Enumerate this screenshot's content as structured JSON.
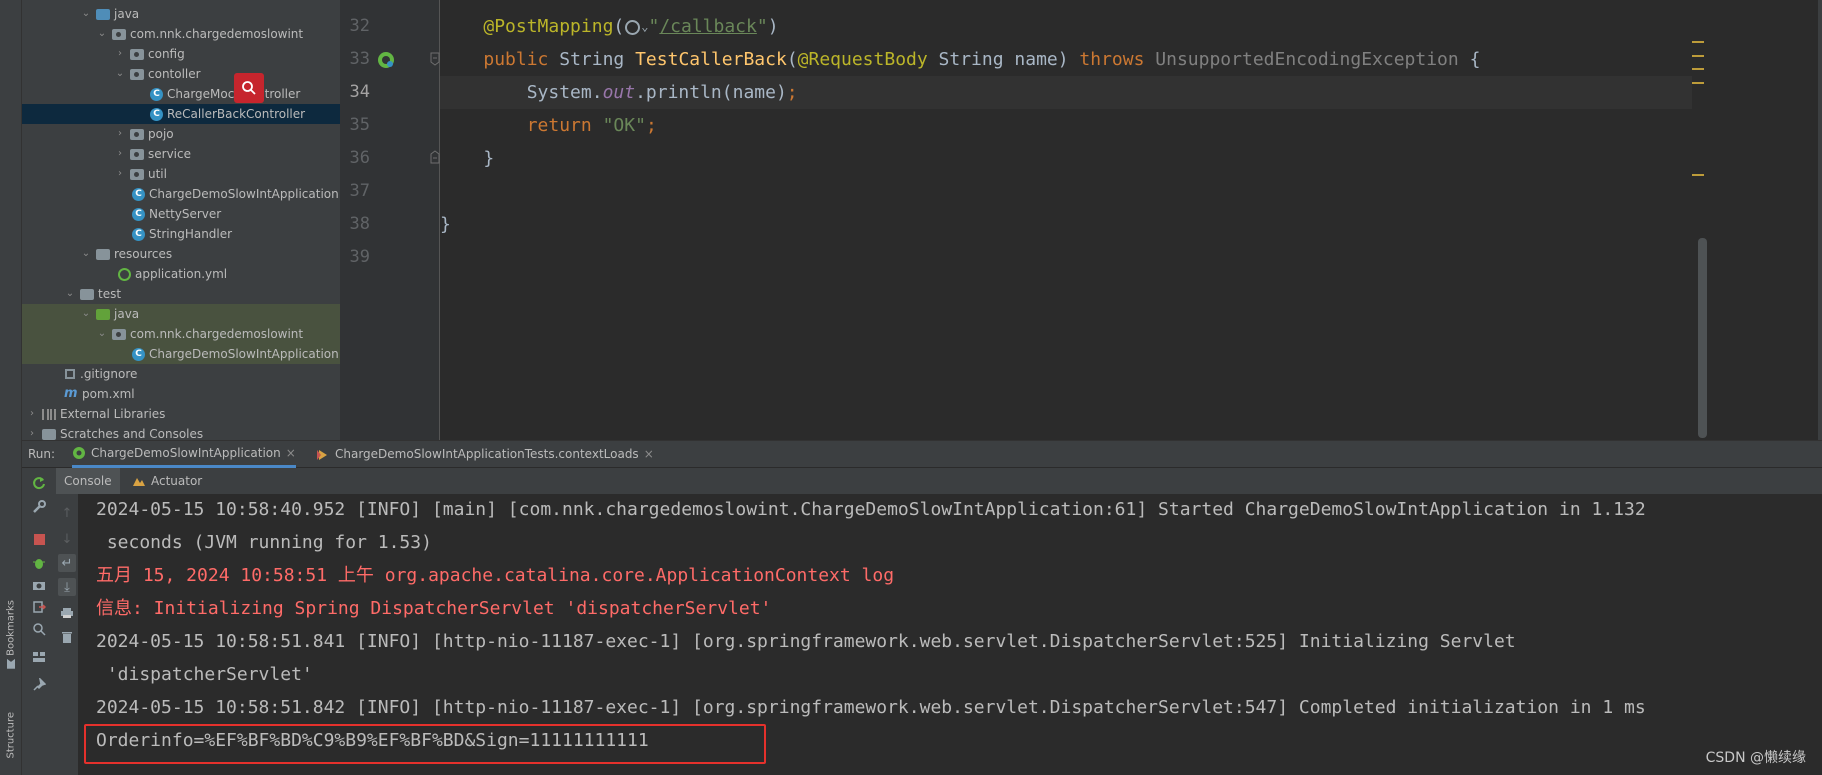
{
  "left_strip": {
    "bookmarks_label": "Bookmarks",
    "structure_label": "Structure"
  },
  "tree": {
    "items": [
      {
        "label": "java",
        "icon": "folder-icon"
      },
      {
        "label": "com.nnk.chargedemoslowint",
        "icon": "package-icon"
      },
      {
        "label": "config",
        "icon": "package-icon"
      },
      {
        "label": "contoller",
        "icon": "package-icon"
      },
      {
        "label": "ChargeMockController",
        "icon": "class-icon"
      },
      {
        "label": "ReCallerBackController",
        "icon": "class-icon"
      },
      {
        "label": "pojo",
        "icon": "package-icon"
      },
      {
        "label": "service",
        "icon": "package-icon"
      },
      {
        "label": "util",
        "icon": "package-icon"
      },
      {
        "label": "ChargeDemoSlowIntApplication",
        "icon": "class-icon"
      },
      {
        "label": "NettyServer",
        "icon": "class-icon"
      },
      {
        "label": "StringHandler",
        "icon": "class-icon"
      },
      {
        "label": "resources",
        "icon": "folder-icon"
      },
      {
        "label": "application.yml",
        "icon": "yml-icon"
      },
      {
        "label": "test",
        "icon": "folder-icon"
      },
      {
        "label": "java",
        "icon": "folder-icon"
      },
      {
        "label": "com.nnk.chargedemoslowint",
        "icon": "package-icon"
      },
      {
        "label": "ChargeDemoSlowIntApplication",
        "icon": "class-icon"
      },
      {
        "label": ".gitignore",
        "icon": "git-icon"
      },
      {
        "label": "pom.xml",
        "icon": "maven-icon"
      },
      {
        "label": "External Libraries",
        "icon": "library-icon"
      },
      {
        "label": "Scratches and Consoles",
        "icon": "scratch-icon"
      }
    ]
  },
  "editor": {
    "line_numbers": [
      "32",
      "33",
      "34",
      "35",
      "36",
      "37",
      "38",
      "39"
    ],
    "lines": {
      "l32": {
        "ann": "@PostMapping",
        "open": "(",
        "quote_open": "\"",
        "path": "/callback",
        "quote_close": "\"",
        "close": ")"
      },
      "l33": {
        "kw_public": "public",
        "type": " String ",
        "method": "TestCallerBack",
        "paren": "(",
        "ann": "@RequestBody",
        "param": " String name) ",
        "kw_throws": "throws",
        "exception": " UnsupportedEncodingException",
        "brace": " {"
      },
      "l34": {
        "text": "System.",
        "field": "out",
        "call": ".println(name)",
        "semi": ";"
      },
      "l35": {
        "kw_return": "return",
        "space": " ",
        "value": "\"OK\"",
        "semi": ";"
      },
      "l36": {
        "text": "}"
      },
      "l38": {
        "text": "}"
      }
    }
  },
  "run": {
    "label": "Run:",
    "tabs": [
      {
        "label": "ChargeDemoSlowIntApplication"
      },
      {
        "label": "ChargeDemoSlowIntApplicationTests.contextLoads"
      }
    ],
    "close_glyph": "×",
    "sub_tabs": [
      {
        "label": "Console"
      },
      {
        "label": "Actuator"
      }
    ]
  },
  "console": {
    "lines": [
      {
        "text": "2024-05-15 10:58:40.952 [INFO] [main] [com.nnk.chargedemoslowint.ChargeDemoSlowIntApplication:61] Started ChargeDemoSlowIntApplication in 1.132",
        "kind": "info"
      },
      {
        "text": " seconds (JVM running for 1.53)",
        "kind": "info"
      },
      {
        "text": "五月 15, 2024 10:58:51 上午 org.apache.catalina.core.ApplicationContext log",
        "kind": "err"
      },
      {
        "text": "信息: Initializing Spring DispatcherServlet 'dispatcherServlet'",
        "kind": "err"
      },
      {
        "text": "2024-05-15 10:58:51.841 [INFO] [http-nio-11187-exec-1] [org.springframework.web.servlet.DispatcherServlet:525] Initializing Servlet",
        "kind": "info"
      },
      {
        "text": " 'dispatcherServlet'",
        "kind": "info"
      },
      {
        "text": "2024-05-15 10:58:51.842 [INFO] [http-nio-11187-exec-1] [org.springframework.web.servlet.DispatcherServlet:547] Completed initialization in 1 ms",
        "kind": "info"
      },
      {
        "text": "Orderinfo=%EF%BF%BD%C9%B9%EF%BF%BD&Sign=11111111111",
        "kind": "info"
      }
    ],
    "error_color": "#ff6b68",
    "highlight_color": "#e5312c"
  },
  "watermark": "CSDN @懒续缘",
  "colors": {
    "accent": "#4a88c7",
    "keyword": "#cc7832",
    "annotation": "#bbb529",
    "string": "#6a8759",
    "method": "#ffc66d"
  }
}
